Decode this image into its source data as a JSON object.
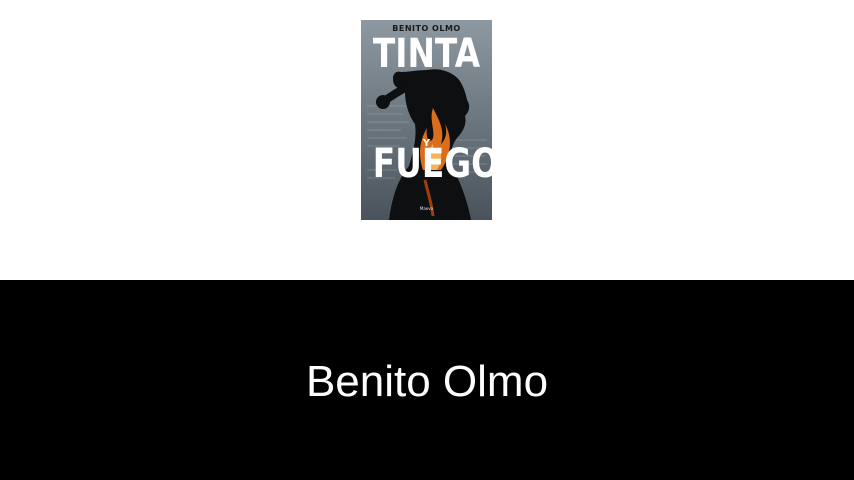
{
  "book": {
    "cover_author": "BENITO OLMO",
    "title_line_1": "TINTA",
    "title_connector": "Y",
    "title_line_2": "FUEGO",
    "publisher": "Maeva"
  },
  "caption": {
    "author_name": "Benito Olmo"
  },
  "colors": {
    "band_background": "#000000",
    "page_background": "#ffffff",
    "caption_text": "#ffffff",
    "flame": "#e8731c"
  }
}
